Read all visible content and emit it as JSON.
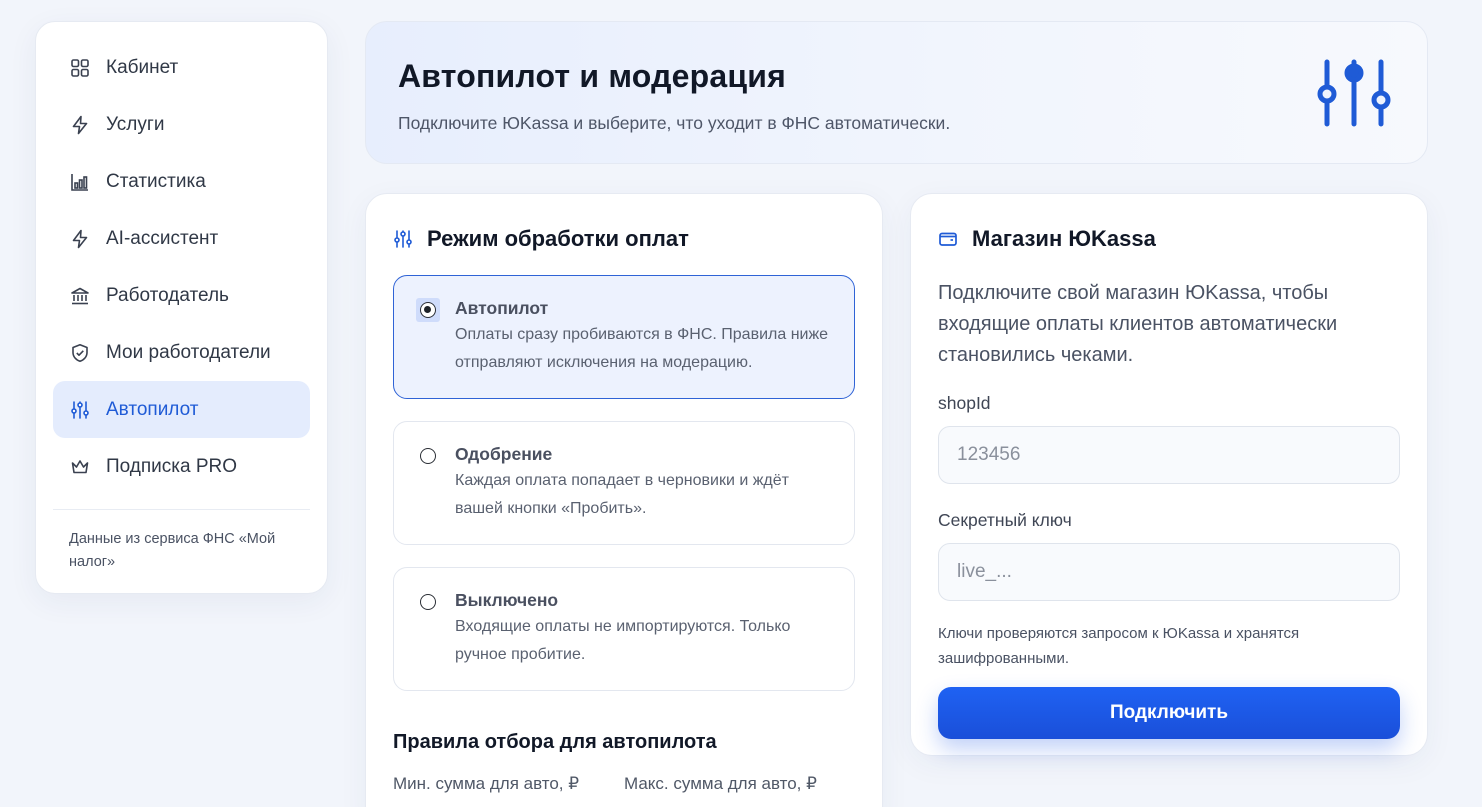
{
  "sidebar": {
    "items": [
      {
        "label": "Кабинет",
        "icon": "grid-icon"
      },
      {
        "label": "Услуги",
        "icon": "lightning-icon"
      },
      {
        "label": "Статистика",
        "icon": "bar-chart-icon"
      },
      {
        "label": "AI-ассистент",
        "icon": "lightning-icon"
      },
      {
        "label": "Работодатель",
        "icon": "bank-icon"
      },
      {
        "label": "Мои работодатели",
        "icon": "shield-check-icon"
      },
      {
        "label": "Автопилот",
        "icon": "sliders-icon",
        "active": true
      },
      {
        "label": "Подписка PRO",
        "icon": "crown-icon"
      }
    ],
    "footer": "Данные из сервиса ФНС «Мой налог»"
  },
  "header": {
    "title": "Автопилот и модерация",
    "subtitle": "Подключите ЮKassa и выберите, что уходит в ФНС автоматически."
  },
  "mode_card": {
    "title": "Режим обработки оплат",
    "options": [
      {
        "title": "Автопилот",
        "desc": "Оплаты сразу пробиваются в ФНС. Правила ниже отправляют исключения на модерацию.",
        "selected": true
      },
      {
        "title": "Одобрение",
        "desc": "Каждая оплата попадает в черновики и ждёт вашей кнопки «Пробить».",
        "selected": false
      },
      {
        "title": "Выключено",
        "desc": "Входящие оплаты не импортируются. Только ручное пробитие.",
        "selected": false
      }
    ],
    "rules_title": "Правила отбора для автопилота",
    "min_label": "Мин. сумма для авто, ₽",
    "max_label": "Макс. сумма для авто, ₽"
  },
  "shop_card": {
    "title": "Магазин ЮKassa",
    "description": "Подключите свой магазин ЮKassa, чтобы входящие оплаты клиентов автоматически становились чеками.",
    "shop_id_label": "shopId",
    "shop_id_placeholder": "123456",
    "secret_label": "Секретный ключ",
    "secret_placeholder": "live_...",
    "hint": "Ключи проверяются запросом к ЮKassa и хранятся зашифрованными.",
    "connect_label": "Подключить"
  },
  "colors": {
    "accent": "#1f5bd6",
    "button": "#1a56e6",
    "active_bg": "#e4ecfd"
  }
}
